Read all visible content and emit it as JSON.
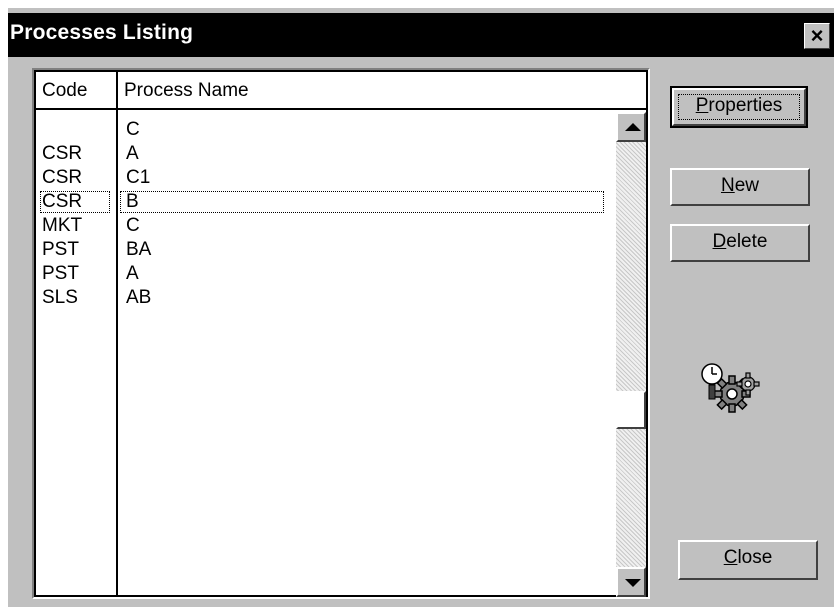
{
  "window": {
    "title": "Processes Listing",
    "close_glyph": "×"
  },
  "list": {
    "columns": [
      "Code",
      "Process Name"
    ],
    "rows": [
      {
        "code": "",
        "name": "C"
      },
      {
        "code": "CSR",
        "name": "A"
      },
      {
        "code": "CSR",
        "name": "C1"
      },
      {
        "code": "CSR",
        "name": "B",
        "focused": true
      },
      {
        "code": "MKT",
        "name": "C"
      },
      {
        "code": "PST",
        "name": "BA"
      },
      {
        "code": "PST",
        "name": "A"
      },
      {
        "code": "SLS",
        "name": "AB"
      }
    ]
  },
  "buttons": {
    "properties": {
      "mnemonic": "P",
      "rest": "roperties"
    },
    "new": {
      "mnemonic": "N",
      "rest": "ew"
    },
    "delete": {
      "mnemonic": "D",
      "rest": "elete"
    },
    "close": {
      "mnemonic": "C",
      "rest": "lose"
    }
  },
  "icons": {
    "process": "gear-clock-icon"
  },
  "colors": {
    "titlebar": "#000000",
    "face": "#c0c0c0"
  }
}
